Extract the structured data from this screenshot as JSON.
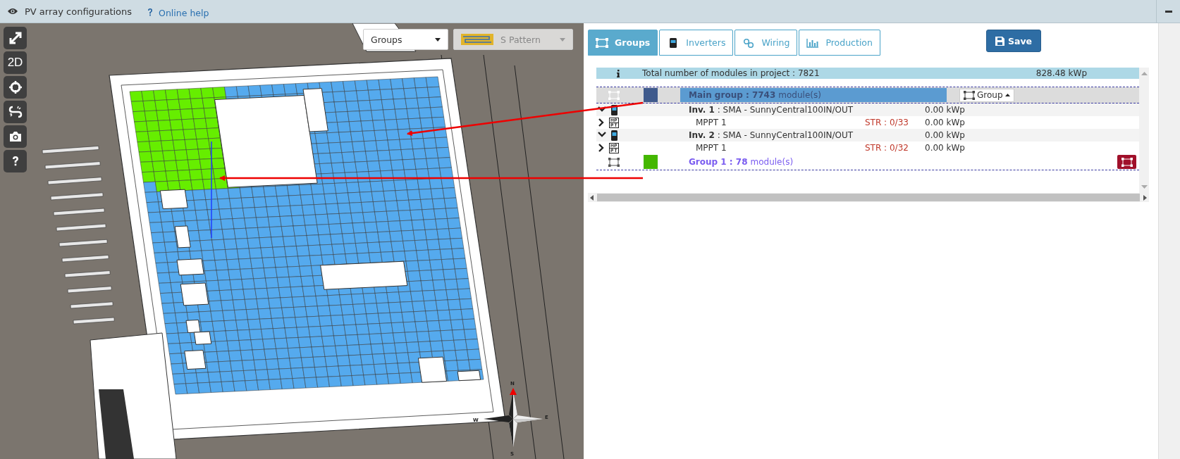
{
  "header": {
    "title": "PV array configurations",
    "help_link": "Online help"
  },
  "view_tools": [
    {
      "kind": "expand"
    },
    {
      "kind": "text",
      "label": "2D"
    },
    {
      "kind": "center"
    },
    {
      "kind": "unlink"
    },
    {
      "kind": "camera"
    },
    {
      "kind": "help"
    }
  ],
  "display_mode": {
    "value": "Groups"
  },
  "pattern": {
    "value": "S Pattern",
    "disabled": true
  },
  "compass": {
    "north": "N",
    "east": "E",
    "south": "S",
    "west": "W"
  },
  "tabs": [
    {
      "kind": "groups",
      "label": "Groups",
      "selected": true
    },
    {
      "kind": "inverters",
      "label": "Inverters",
      "selected": false
    },
    {
      "kind": "wiring",
      "label": "Wiring",
      "selected": false
    },
    {
      "kind": "production",
      "label": "Production",
      "selected": false
    }
  ],
  "save_button": "Save",
  "summary": {
    "text": "Total number of modules in project : 7821",
    "power": "828.48 kWp"
  },
  "groups": [
    {
      "kind": "main",
      "label": "**Main group : 7743** module(s)",
      "color": "#3f5a8c",
      "selected": true,
      "menu": "Group",
      "inverters": [
        {
          "label": "**Inv. 1** : SMA - SunnyCentral100IN/OUT",
          "power": "0.00 kWp",
          "expanded": true,
          "mppts": [
            {
              "label": "MPPT 1",
              "strings": "STR : 0/33",
              "power": "0.00 kWp",
              "expanded": false
            }
          ]
        },
        {
          "label": "**Inv. 2** : SMA - SunnyCentral100IN/OUT",
          "power": "0.00 kWp",
          "expanded": true,
          "mppts": [
            {
              "label": "MPPT 1",
              "strings": "STR : 0/32",
              "power": "0.00 kWp",
              "expanded": false
            }
          ]
        }
      ]
    },
    {
      "kind": "sub",
      "label": "**Group 1 : 78** module(s)",
      "color": "#44b700",
      "selected": false
    }
  ]
}
